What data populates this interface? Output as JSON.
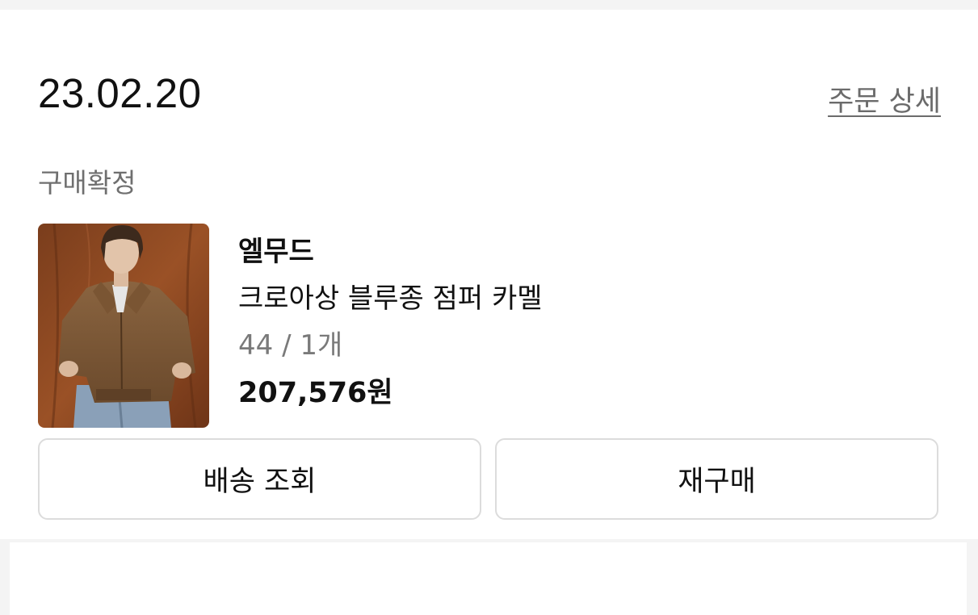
{
  "order": {
    "date": "23.02.20",
    "detail_link": "주문 상세",
    "status": "구매확정"
  },
  "product": {
    "brand": "엘무드",
    "name": "크로아상 블루종 점퍼 카멜",
    "option": "44 / 1개",
    "price": "207,576원",
    "thumbnail_icon": "product-photo-jacket"
  },
  "actions": {
    "track_label": "배송 조회",
    "reorder_label": "재구매"
  },
  "colors": {
    "background": "#f4f4f4",
    "card": "#ffffff",
    "text_primary": "#111111",
    "text_secondary": "#6f6f6f",
    "button_border": "#dcdcdc"
  }
}
